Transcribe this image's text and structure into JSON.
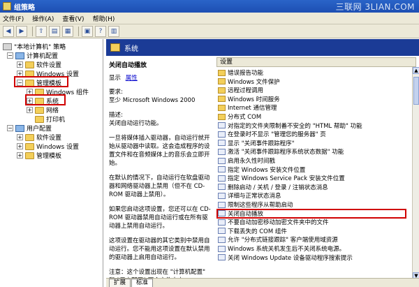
{
  "window": {
    "title": "组策略",
    "watermark": "三联网 3LIAN.COM"
  },
  "menu": [
    "文件(F)",
    "操作(A)",
    "查看(V)",
    "帮助(H)"
  ],
  "toolbar_icons": [
    "back-icon",
    "forward-icon",
    "up-folder-icon",
    "show-hide-tree-icon",
    "export-list-icon",
    "properties-icon",
    "help-icon",
    "show-extended-icon"
  ],
  "tree": {
    "root": "\"本地计算机\" 策略",
    "computer_config": "计算机配置",
    "software_settings": "软件设置",
    "windows_settings": "Windows 设置",
    "admin_templates": "管理模板",
    "windows_components": "Windows 组件",
    "system": "系统",
    "network": "网络",
    "printers": "打印机",
    "user_config": "用户配置",
    "user_software_settings": "软件设置",
    "user_windows_settings": "Windows 设置",
    "user_admin_templates": "管理模板"
  },
  "header": {
    "title": "系统"
  },
  "description": {
    "title": "关闭自动播放",
    "show_label": "显示",
    "properties_link": "属性",
    "requirements_label": "要求:",
    "requirements_value": "至少 Microsoft Windows 2000",
    "desc_label": "描述:",
    "paragraphs": [
      "关闭自动运行功能。",
      "一旦将媒体插入驱动器，自动运行就开始从驱动器中读取。这会造成程序的设置文件和在音频媒体上的音乐会立即开始。",
      "在默认的情况下，自动运行在软盘驱动器和网络驱动器上禁用（但不在 CD-ROM 驱动器上禁用）。",
      "如果您启动这项设置，您还可以在 CD-ROM 驱动器禁用自动运行或在所有驱动器上禁用自动运行。",
      "这项设置在驱动器的其它类别中禁用自动运行。您不能用这项设置在默认禁用的驱动器上启用自动运行。",
      "注意：这个设置出现在 \"计算机配置\" 和 \"用户配置\" 两个文件夹中。"
    ]
  },
  "list": {
    "column_header": "设置",
    "items": [
      {
        "text": "错误报告功能",
        "kind": "folder"
      },
      {
        "text": "Windows 文件保护",
        "kind": "folder"
      },
      {
        "text": "远程过程调用",
        "kind": "folder"
      },
      {
        "text": "Windows 时间服务",
        "kind": "folder"
      },
      {
        "text": "Internet 通信管理",
        "kind": "folder"
      },
      {
        "text": "分布式 COM",
        "kind": "folder"
      },
      {
        "text": "对指定的文件夹限制番不安全的 \"HTML 帮助\" 功能",
        "kind": "setting"
      },
      {
        "text": "在登录时不显示 \"管理您的服务器\" 页",
        "kind": "setting"
      },
      {
        "text": "显示 \"关闭事件跟踪程序\"",
        "kind": "setting"
      },
      {
        "text": "激活 \"关闭事件跟踪程序系统状态数据\" 功能",
        "kind": "setting"
      },
      {
        "text": "启用永久性时间戳",
        "kind": "setting"
      },
      {
        "text": "指定 Windows 安装文件位置",
        "kind": "setting"
      },
      {
        "text": "指定 Windows Service Pack 安装文件位置",
        "kind": "setting"
      },
      {
        "text": "删除启动 / 关机 / 登录 / 注销状态消息",
        "kind": "setting"
      },
      {
        "text": "详细与正常状态消息",
        "kind": "setting"
      },
      {
        "text": "限制这些程序从帮助启动",
        "kind": "setting"
      },
      {
        "text": "关闭自动播放",
        "kind": "setting"
      },
      {
        "text": "不要自动加密移动加密文件夹中的文件",
        "kind": "setting"
      },
      {
        "text": "下载丢失的 COM 组件",
        "kind": "setting"
      },
      {
        "text": "允许 \"分布式链接跟踪\" 客户端使用域资源",
        "kind": "setting"
      },
      {
        "text": "Windows 系统关机发生后不关闭系统电源。",
        "kind": "setting"
      },
      {
        "text": "关闭 Windows Update 设备驱动程序搜索提示",
        "kind": "setting"
      }
    ]
  },
  "tabs": [
    "扩展",
    "标准"
  ],
  "colors": {
    "highlight_box": "#d00000",
    "header_bg": "#1b3b96"
  }
}
